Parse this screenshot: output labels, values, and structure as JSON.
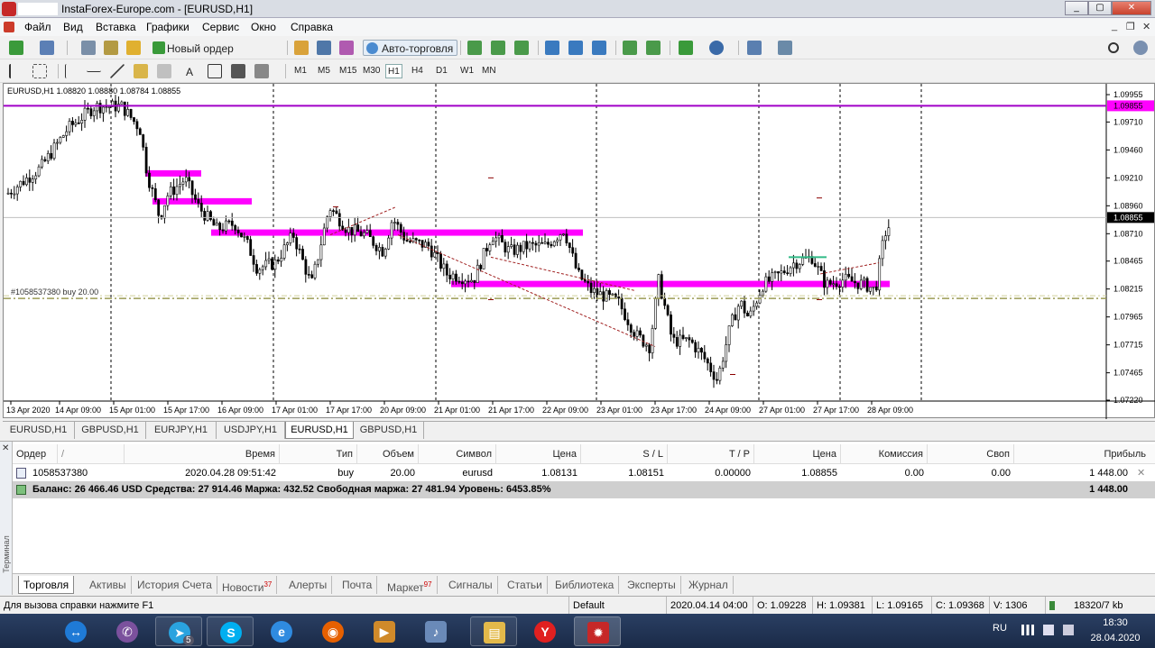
{
  "window": {
    "title": "InstaForex-Europe.com - [EURUSD,H1]",
    "controls": [
      "_",
      "▢",
      "✕"
    ]
  },
  "menu": {
    "items": [
      "Файл",
      "Вид",
      "Вставка",
      "Графики",
      "Сервис",
      "Окно",
      "Справка"
    ],
    "mdi_controls": [
      "_",
      "❐",
      "✕"
    ]
  },
  "toolbar": {
    "new_order": "Новый ордер",
    "auto_trading": "Авто-торговля"
  },
  "drawing_toolbar": {
    "text_tool": "A",
    "timeframes": [
      "M1",
      "M5",
      "M15",
      "M30",
      "H1",
      "H4",
      "D1",
      "W1",
      "MN"
    ],
    "active_timeframe": "H1"
  },
  "chart": {
    "header": "EURUSD,H1  1.08820 1.08880 1.08784 1.08855",
    "order_label": "#1058537380 buy 20.00",
    "price_labels": [
      "1.09955",
      "1.09710",
      "1.09460",
      "1.09210",
      "1.08960",
      "1.08710",
      "1.08465",
      "1.08215",
      "1.07965",
      "1.07715",
      "1.07465",
      "1.07220"
    ],
    "line_label": "1.09855",
    "current_price": "1.08855",
    "date_labels": [
      "13 Apr 2020",
      "14 Apr 09:00",
      "15 Apr 01:00",
      "15 Apr 17:00",
      "16 Apr 09:00",
      "17 Apr 01:00",
      "17 Apr 17:00",
      "20 Apr 09:00",
      "21 Apr 01:00",
      "21 Apr 17:00",
      "22 Apr 09:00",
      "23 Apr 01:00",
      "23 Apr 17:00",
      "24 Apr 09:00",
      "27 Apr 01:00",
      "27 Apr 17:00",
      "28 Apr 09:00"
    ],
    "colors": {
      "candle": "#000000",
      "magenta_zone": "#ff00ff",
      "purple_line": "#a000c8",
      "order_line": "#9c9c55",
      "current_price_bg": "#000000"
    },
    "series": {
      "type": "candlestick",
      "symbol": "EURUSD",
      "timeframe": "H1",
      "last": {
        "open": 1.0882,
        "high": 1.0888,
        "low": 1.08784,
        "close": 1.08855
      }
    }
  },
  "chart_tabs": [
    "EURUSD,H1",
    "GBPUSD,H1",
    "EURJPY,H1",
    "USDJPY,H1",
    "EURUSD,H1",
    "GBPUSD,H1"
  ],
  "active_chart_tab": 4,
  "terminal": {
    "side_label": "Терминал",
    "columns": [
      "Ордер",
      "/",
      "Время",
      "Тип",
      "Объем",
      "Символ",
      "Цена",
      "S / L",
      "T / P",
      "Цена",
      "Комиссия",
      "Своп",
      "Прибыль"
    ],
    "order": {
      "ticket": "1058537380",
      "time": "2020.04.28 09:51:42",
      "type": "buy",
      "volume": "20.00",
      "symbol": "eurusd",
      "price": "1.08131",
      "sl": "1.08151",
      "tp": "0.00000",
      "current": "1.08855",
      "commission": "0.00",
      "swap": "0.00",
      "profit": "1 448.00"
    },
    "balance_line": "Баланс: 26 466.46 USD  Средства: 27 914.46  Маржа: 432.52  Свободная маржа: 27 481.94  Уровень: 6453.85%",
    "balance_profit": "1 448.00",
    "tabs": [
      {
        "label": "Торговля"
      },
      {
        "label": "Активы"
      },
      {
        "label": "История Счета"
      },
      {
        "label": "Новости",
        "badge": "37"
      },
      {
        "label": "Алерты"
      },
      {
        "label": "Почта"
      },
      {
        "label": "Маркет",
        "badge": "97"
      },
      {
        "label": "Сигналы"
      },
      {
        "label": "Статьи"
      },
      {
        "label": "Библиотека"
      },
      {
        "label": "Эксперты"
      },
      {
        "label": "Журнал"
      }
    ]
  },
  "status": {
    "help": "Для вызова справки нажмите F1",
    "profile": "Default",
    "datetime": "2020.04.14 04:00",
    "open": "O: 1.09228",
    "high": "H: 1.09381",
    "low": "L: 1.09165",
    "close": "C: 1.09368",
    "volume": "V: 1306",
    "traffic": "18320/7 kb"
  },
  "taskbar": {
    "telegram_badge": "5",
    "lang": "RU",
    "time": "18:30",
    "date": "28.04.2020"
  }
}
